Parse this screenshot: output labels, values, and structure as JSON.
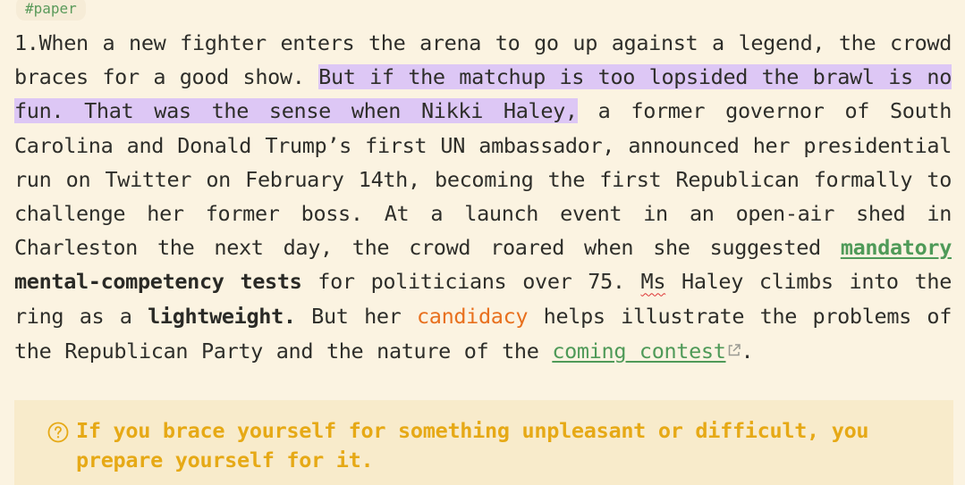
{
  "tag": "#paper",
  "paragraph": {
    "number": "1.",
    "s1": "When a new fighter enters the arena to go up against a legend, the crowd braces for a good show. ",
    "highlighted": "But if the matchup is too lopsided the brawl is no fun. That was the sense when Nikki Haley,",
    "s2": " a former governor of South Carolina and Donald Trump’s first UN ambassador, announced her presidential run on Twitter on February 14th, becoming the first Republican formally to challenge her former boss. At a launch event in an open-air shed in Charleston the next day, the crowd roared when she suggested ",
    "link_mandatory": "mandatory",
    "space": " ",
    "bold_tests": "mental-competency tests",
    "s3": " for politicians over 75. ",
    "ms": "Ms",
    "s4": " Haley climbs into the ring as a ",
    "bold_lightweight": "lightweight.",
    "s5": " But her ",
    "candidacy": "candidacy",
    "s6": " helps illustrate the problems of the Republican Party and the nature of the ",
    "link_contest": "coming contest",
    "s7": "."
  },
  "note": {
    "icon": "question-circle-icon",
    "text": "If you brace yourself for something unpleasant or difficult, you prepare yourself for it."
  },
  "colors": {
    "background": "#fbf3e1",
    "highlight": "#ddc7f5",
    "link_green": "#4f9a58",
    "candidacy_orange": "#e8701e",
    "note_text": "#e6a916",
    "note_background": "#f8ebcb"
  }
}
